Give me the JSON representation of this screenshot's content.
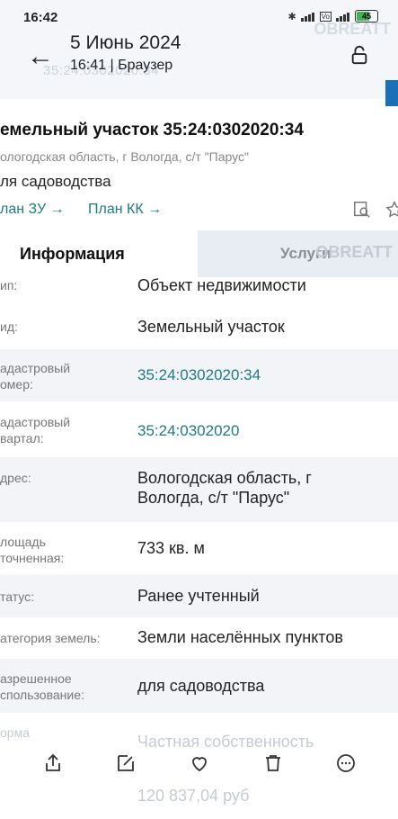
{
  "status_bar": {
    "time": "16:42",
    "battery": "45"
  },
  "header": {
    "title": "5 Июнь 2024",
    "subtitle": "16:41 | Браузер",
    "ghost_text": "35:24:0302020:34",
    "ghost_brand": "OBREATT"
  },
  "object": {
    "title": "емельный участок 35:24:0302020:34",
    "address": "ологодская область, г Вологда, с/т \"Парус\"",
    "use": "ля садоводства",
    "plan_zu": "лан ЗУ →",
    "plan_kk": "План КК →"
  },
  "tabs": {
    "info": "Информация",
    "services": "Услуги",
    "ghost": "ОВREATT"
  },
  "rows": [
    {
      "label": "ип:",
      "value": "Объект недвижимости"
    },
    {
      "label": "ид:",
      "value": "Земельный участок"
    },
    {
      "label": "адастровый\nомер:",
      "value": "35:24:0302020:34"
    },
    {
      "label": "адастровый\nвартал:",
      "value": "35:24:0302020"
    },
    {
      "label": "дрес:",
      "value": "Вологодская область, г\nВологда, с/т \"Парус\""
    },
    {
      "label": "лощадь\nточненная:",
      "value": "733 кв. м"
    },
    {
      "label": "татус:",
      "value": "Ранее учтенный"
    },
    {
      "label": "атегория земель:",
      "value": "Земли населённых пунктов"
    },
    {
      "label": "азрешенное\nспользование:",
      "value": "для садоводства"
    }
  ],
  "faded": {
    "label1": "орма",
    "value1": "Частная собственность",
    "value2": "120 837,04 руб"
  },
  "colors": {
    "link": "#1f7a85",
    "accent": "#1a6fb8",
    "battery": "#3fb34f"
  }
}
